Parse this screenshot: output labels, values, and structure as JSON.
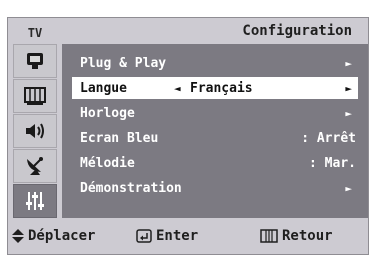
{
  "side": {
    "tab_label": "TV",
    "icons": [
      "input-icon",
      "picture-icon",
      "sound-icon",
      "channel-icon",
      "setup-icon"
    ],
    "active_index": 4
  },
  "header": {
    "title": "Configuration"
  },
  "menu": {
    "items": [
      {
        "label": "Plug & Play",
        "value": "",
        "arrow": "►"
      },
      {
        "label": "Langue",
        "value": "Français",
        "left_arrow": "◄",
        "arrow": "►"
      },
      {
        "label": "Horloge",
        "value": "",
        "arrow": "►"
      },
      {
        "label": "Ecran Bleu",
        "value": ": Arrêt"
      },
      {
        "label": "Mélodie",
        "value": ": Mar."
      },
      {
        "label": "Démonstration",
        "value": "",
        "arrow": "►"
      }
    ],
    "selected_index": 1
  },
  "footer": {
    "move_label": "Déplacer",
    "enter_label": "Enter",
    "back_label": "Retour"
  }
}
